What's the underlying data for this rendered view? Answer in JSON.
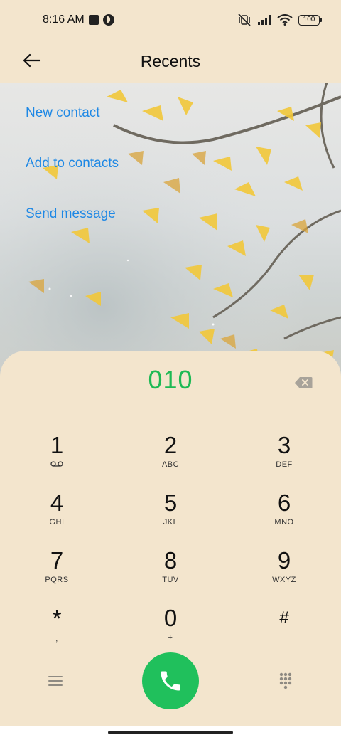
{
  "status_bar": {
    "time": "8:16 AM",
    "battery": "100",
    "icons": [
      "square-notification-icon",
      "circle-notification-icon",
      "vibrate-off-icon",
      "signal-icon",
      "wifi-icon",
      "battery-icon"
    ]
  },
  "header": {
    "title": "Recents",
    "back_icon": "arrow-left-icon"
  },
  "actions": {
    "new_contact": "New contact",
    "add_to_contacts": "Add to contacts",
    "send_message": "Send message"
  },
  "dialer": {
    "number": "010",
    "backspace_icon": "backspace-icon",
    "keys": [
      {
        "digit": "1",
        "letters": ""
      },
      {
        "digit": "2",
        "letters": "ABC"
      },
      {
        "digit": "3",
        "letters": "DEF"
      },
      {
        "digit": "4",
        "letters": "GHI"
      },
      {
        "digit": "5",
        "letters": "JKL"
      },
      {
        "digit": "6",
        "letters": "MNO"
      },
      {
        "digit": "7",
        "letters": "PQRS"
      },
      {
        "digit": "8",
        "letters": "TUV"
      },
      {
        "digit": "9",
        "letters": "WXYZ"
      },
      {
        "digit": "*",
        "letters": ","
      },
      {
        "digit": "0",
        "letters": "+"
      },
      {
        "digit": "#",
        "letters": ""
      }
    ],
    "menu_icon": "menu-icon",
    "call_icon": "phone-icon",
    "keypad_icon": "keypad-grid-icon"
  },
  "colors": {
    "background": "#f3e5cd",
    "link": "#1e88e5",
    "number": "#1db954",
    "call_button": "#20c05c"
  }
}
